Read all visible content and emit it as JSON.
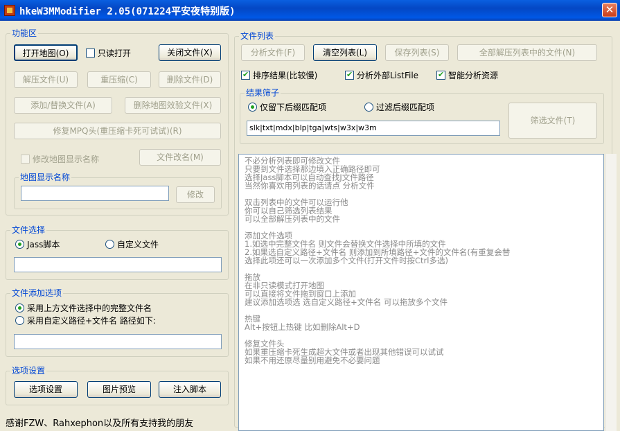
{
  "title": "hkeW3MModifier 2.05(071224平安夜特别版)",
  "left": {
    "func_group": "功能区",
    "open_map": "打开地图(O)",
    "readonly": "只读打开",
    "close_file": "关闭文件(X)",
    "extract_file": "解压文件(U)",
    "recompress": "重压缩(C)",
    "delete_file": "删除文件(D)",
    "add_replace": "添加/替换文件(A)",
    "delete_checksum": "删除地图效验文件(X)",
    "repair_mpq": "修复MPQ头(重压缩卡死可试试)(R)",
    "modify_name": "修改地图显示名称",
    "rename_file": "文件改名(M)",
    "map_name_group": "地图显示名称",
    "modify_btn": "修改",
    "file_select_group": "文件选择",
    "jass": "Jass脚本",
    "custom_file": "自定义文件",
    "add_options_group": "文件添加选项",
    "opt_full": "采用上方文件选择中的完整文件名",
    "opt_custom": "采用自定义路径+文件名 路径如下:",
    "settings_group": "选项设置",
    "settings_btn": "选项设置",
    "preview_btn": "图片预览",
    "inject_btn": "注入脚本",
    "footer": "感谢FZW、Rahxephon以及所有支持我的朋友"
  },
  "right": {
    "list_group": "文件列表",
    "analyze": "分析文件(F)",
    "clear_list": "清空列表(L)",
    "save_list": "保存列表(S)",
    "extract_all": "全部解压列表中的文件(N)",
    "sort_results": "排序结果(比较慢)",
    "analyze_external": "分析外部ListFile",
    "smart_analyze": "智能分析资源",
    "filter_group": "结果筛子",
    "keep_matching": "仅留下后缀匹配项",
    "filter_matching": "过滤后缀匹配项",
    "filter_value": "slk|txt|mdx|blp|tga|wts|w3x|w3m",
    "filter_btn": "筛选文件(T)",
    "help_lines": [
      "不必分析列表即可修改文件",
      "只要到文件选择那边填入正确路径即可",
      "选择Jass脚本可以自动查找J文件路径",
      "当然你喜欢用列表的话请点 分析文件",
      "",
      "双击列表中的文件可以运行他",
      "你可以自己筛选列表结果",
      "可以全部解压列表中的文件",
      "",
      "添加文件选项",
      "1.如选中完整文件名 则文件会替换文件选择中所填的文件",
      "2.如果选自定义路径+文件名 则添加到所填路径+文件的文件名(有重复会替",
      "  选择此项还可以一次添加多个文件(打开文件时按Ctrl多选)",
      "",
      "拖放",
      "在非只读模式打开地图",
      "可以直接将文件拖到窗口上添加",
      "建议添加选项选 选自定义路径+文件名 可以拖放多个文件",
      "",
      "热键",
      "Alt+按钮上热键 比如删除Alt+D",
      "",
      "修复文件头",
      "如果重压缩卡死生成超大文件或者出现其他错误可以试试",
      "如果不用还原尽量别用避免不必要问题"
    ]
  }
}
